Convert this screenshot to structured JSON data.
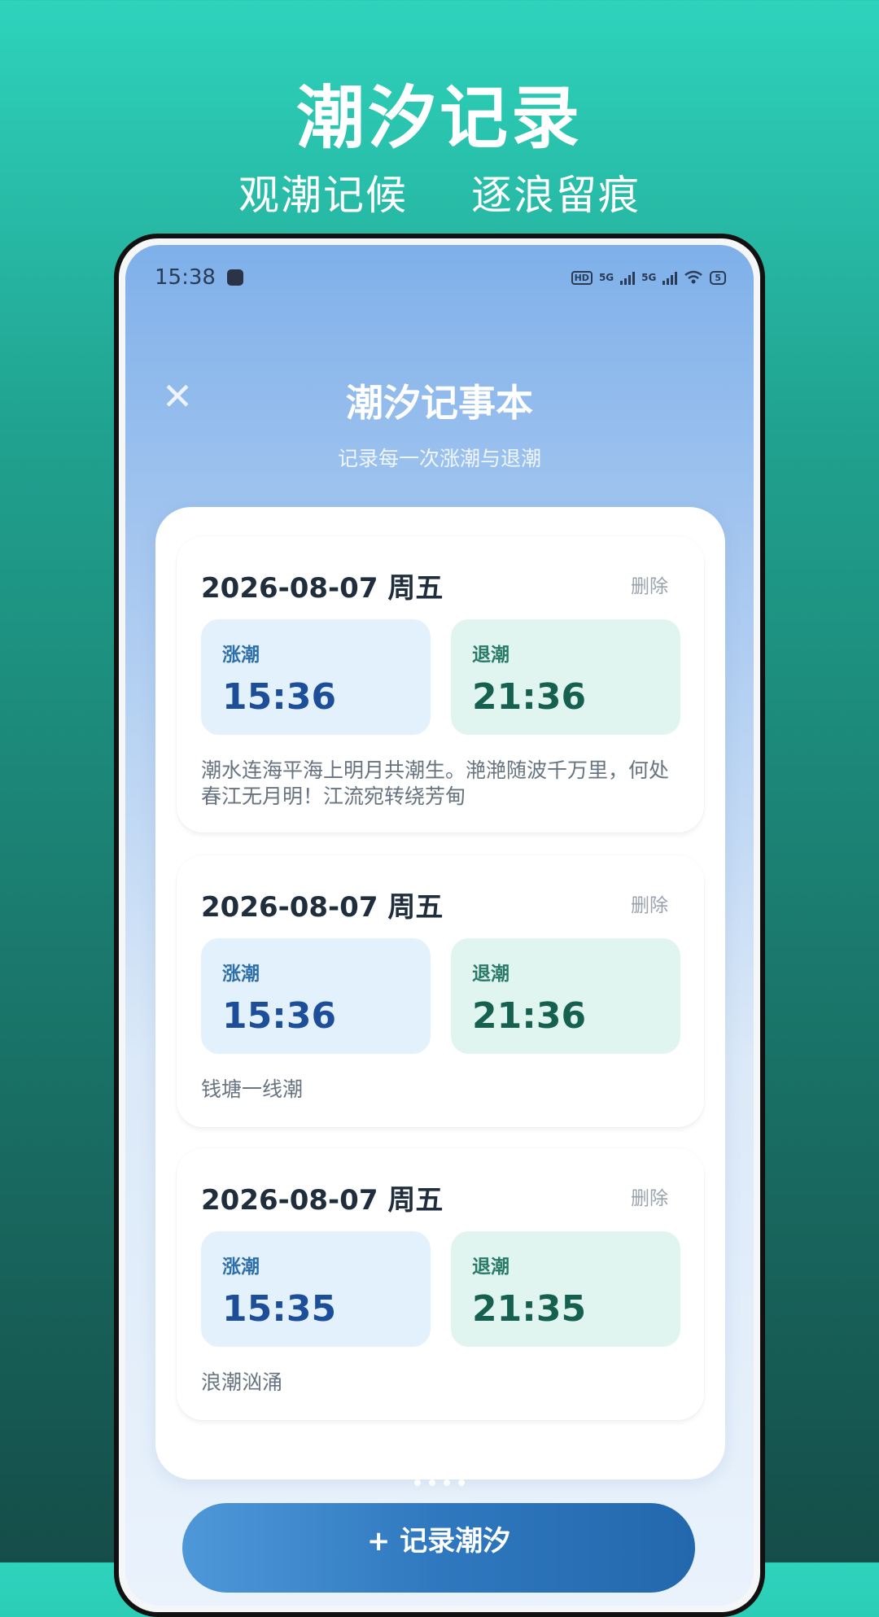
{
  "promo": {
    "title": "潮汐记录",
    "subtitle_left": "观潮记候",
    "subtitle_right": "逐浪留痕"
  },
  "status_bar": {
    "time": "15:38",
    "network_1": "5G",
    "network_2": "5G",
    "hd_label": "HD",
    "battery": "5"
  },
  "app": {
    "title": "潮汐记事本",
    "subtitle": "记录每一次涨潮与退潮",
    "close_icon": "close-icon"
  },
  "records": [
    {
      "date": "2026-08-07  周五",
      "delete_label": "删除",
      "rise_label": "涨潮",
      "rise_time": "15:36",
      "ebb_label": "退潮",
      "ebb_time": "21:36",
      "note": "潮水连海平海上明月共潮生。滟滟随波千万里，何处春江无月明！江流宛转绕芳甸"
    },
    {
      "date": "2026-08-07  周五",
      "delete_label": "删除",
      "rise_label": "涨潮",
      "rise_time": "15:36",
      "ebb_label": "退潮",
      "ebb_time": "21:36",
      "note": "钱塘一线潮"
    },
    {
      "date": "2026-08-07  周五",
      "delete_label": "删除",
      "rise_label": "涨潮",
      "rise_time": "15:35",
      "ebb_label": "退潮",
      "ebb_time": "21:35",
      "note": "浪潮汹涌"
    }
  ],
  "add_button": {
    "label": "+ 记录潮汐"
  },
  "colors": {
    "accent": "#2f78bf",
    "rise_bg": "#e3f1fc",
    "ebb_bg": "#e0f4f0"
  }
}
